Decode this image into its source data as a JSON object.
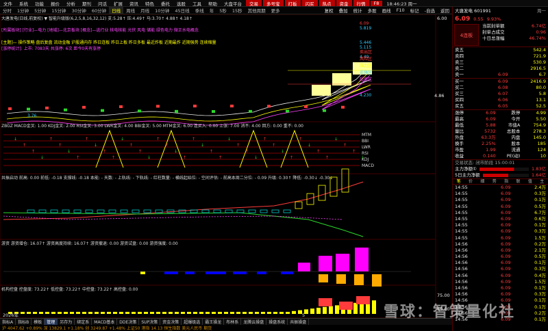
{
  "menu": {
    "items": [
      "文件",
      "系统",
      "功能",
      "报价",
      "分析",
      "期刊",
      "问话",
      "扩展",
      "资讯",
      "特色",
      "委托",
      "选股",
      "工具",
      "帮助",
      "大盘平台"
    ],
    "red_items": [
      "交易",
      "多号宝",
      "打板",
      "闪买",
      "热点",
      "资金",
      "行情",
      "F8"
    ],
    "time": "18:46:23 周一"
  },
  "toolbar": {
    "periods": [
      "分时",
      "1分钟",
      "5分钟",
      "15分钟",
      "30分钟",
      "60分钟",
      "日线",
      "周线",
      "月线",
      "10分钟",
      "45日线",
      "季线",
      "年",
      "5秒",
      "15秒",
      "其他周期",
      "更多"
    ],
    "selected": "日线",
    "right_items": [
      "复权",
      "叠加",
      "统计",
      "多股",
      "画线",
      "F10",
      "标记",
      "-自选",
      "返回"
    ]
  },
  "main_panel": {
    "header": "大唐发电(日线,前复权) ▼ 智能升级版(6,2,5,8,16,32,12) 支:5.28↑ 压:4.49↑ 马:3.70↑ 4.88↑ 4.18↑",
    "line1": "[所属板块]  [行业]—电力  [地域]—北京板块  [概念]—选行业 核电核能 光伏 风电 储能 绿色电力 微正水电概念",
    "line2": "[主题]—  操作策略  盘后复盘 流动金融 沪股通内存 昨日连板 昨日上板 昨日多板 最近炸板 近期最炸 近期强势 连续缩量",
    "line3": "[涨停统计]:  上市: 7083天   共涨停: 6次   距今0天有涨停",
    "price_labels": [
      "6.09",
      "5.819",
      "5.446",
      "5.115",
      "4.230",
      "4.49",
      "3.76"
    ],
    "zone_labels": [
      "卖出区",
      "风险区",
      "压力区",
      "买强区",
      "超卖区"
    ],
    "axis": [
      "6.00",
      "5.00",
      "4.00",
      "4.86"
    ]
  },
  "panel2": {
    "header": "ZBGZ  MACD金叉: 1.00  KDJ金叉: 2.00  RSI金叉: 3.00  LWR金叉: 4.00  BBI金叉: 5.00  MTM金叉: 6.00  连买入: 0.00  上张: 7.00  消不: 4.00  回方: 0.00  重不: 0.00",
    "legend": [
      "MTM",
      "BBI",
      "LWR",
      "RSI",
      "KDJ",
      "MACD"
    ]
  },
  "panel3": {
    "header": "共振启动  前高: 0.00  前低: -0.18  支撑线: -0.18  本能: - 天数: - 上轨线: - 下轨线: - 红柱数量: - 横线起始位: - 空间评估: - 前高本周二分位: - 0.09  升级: 0.30↑  降低: -0.30↓  -0.30↓"
  },
  "panel4": {
    "header": "游资  游资增仓: 16.07↑  游资高度持续: 16.07↑  游资撤退: 0.00  游资试盘: 0.00  游资强度: 0.00"
  },
  "panel5": {
    "header": "机构控盘  控盘度: 73.22↑  低控盘: 73.22↑  中控盘: 73.22↑  高控盘: 0.00",
    "axis": [
      "75.00",
      "50.00"
    ]
  },
  "timeline": {
    "label": "2026年",
    "marker": "5"
  },
  "bottom_tabs": [
    "指标A",
    "指标B",
    "模板",
    "管理",
    "另存为",
    "绑定系",
    "MACD基本",
    "DDE决策",
    "SUP决策",
    "资金决策",
    "超爆级选",
    "霸王操龙",
    "布林系",
    "龙腾云操盘",
    "操盘系统",
    "共振操盘"
  ],
  "bottom_tab_selected": "管理",
  "bottom_status": "沪 4047.62  +0.89%   深 13829.1  +1.18%   创 3249.87  +1.48%   上证50  港指 14.13  恒生指数  美元人民币  期货",
  "quote": {
    "name": "大唐发电 601991",
    "extra": "周一",
    "price": "6.09",
    "change": "0.55",
    "pct": "9.93%",
    "stats": [
      {
        "label": "当前封单额",
        "value": "6.74亿"
      },
      {
        "label": "封单占成交",
        "value": "0.96"
      },
      {
        "label": "十日总涨幅",
        "value": "46.74%"
      }
    ],
    "board_tag": "4连板",
    "asks": [
      {
        "label": "卖五",
        "price": "",
        "vol": "542.4"
      },
      {
        "label": "卖四",
        "price": "",
        "vol": "721.9"
      },
      {
        "label": "卖三",
        "price": "",
        "vol": "530.9"
      },
      {
        "label": "卖二",
        "price": "",
        "vol": "2916.5"
      },
      {
        "label": "卖一",
        "price": "6.09",
        "vol": "6.7"
      }
    ],
    "bids": [
      {
        "label": "买一",
        "price": "6.09",
        "vol": "2416.9"
      },
      {
        "label": "买二",
        "price": "6.08",
        "vol": "80.0"
      },
      {
        "label": "买三",
        "price": "6.07",
        "vol": "5.8"
      },
      {
        "label": "买四",
        "price": "6.06",
        "vol": "13.1"
      },
      {
        "label": "买五",
        "price": "6.05",
        "vol": "52.5"
      }
    ],
    "details": [
      {
        "l1": "涨停",
        "v1": "6.09",
        "l2": "跌停",
        "v2": "4.99"
      },
      {
        "l1": "最高",
        "v1": "6.09",
        "l2": "今开",
        "v2": "5.50"
      },
      {
        "l1": "最低",
        "v1": "5.88",
        "l2": "市值A",
        "v2": "754.9"
      },
      {
        "l1": "量比",
        "v1": "5732",
        "l2": "总股本",
        "v2": "278.3"
      },
      {
        "l1": "外盘",
        "v1": "63.3万",
        "l2": "内盘",
        "v2": "145.0"
      },
      {
        "l1": "换手",
        "v1": "2.25%",
        "l2": "股本",
        "v2": "185"
      },
      {
        "l1": "市盈",
        "v1": "1.99",
        "l2": "流通",
        "v2": "124"
      },
      {
        "l1": "收益",
        "v1": "0.140",
        "l2": "PE(动)",
        "v2": "10"
      }
    ],
    "status": "交易状态: 闭市阶段 15:00:01",
    "flows": [
      {
        "label": "主力净额①",
        "value": "1.83亿"
      },
      {
        "label": "5日主力净额",
        "value": "1.64亿"
      }
    ],
    "tabs": [
      "笔",
      "价",
      "细",
      "势",
      "指",
      "联",
      "值",
      "主"
    ],
    "ticks": [
      {
        "t": "14:55",
        "p": "6.09",
        "v": "2.4万"
      },
      {
        "t": "14:55",
        "p": "6.09",
        "v": "0.3万"
      },
      {
        "t": "14:55",
        "p": "6.09",
        "v": "0.1万"
      },
      {
        "t": "14:55",
        "p": "6.09",
        "v": "0.5万"
      },
      {
        "t": "14:55",
        "p": "6.09",
        "v": "6.7万"
      },
      {
        "t": "14:55",
        "p": "6.09",
        "v": "0.6万"
      },
      {
        "t": "14:55",
        "p": "6.09",
        "v": "0.1万"
      },
      {
        "t": "14:55",
        "p": "6.09",
        "v": "0.3万"
      },
      {
        "t": "14:55",
        "p": "6.09",
        "v": "1.5万"
      },
      {
        "t": "14:56",
        "p": "6.09",
        "v": "0.2万"
      },
      {
        "t": "14:56",
        "p": "6.09",
        "v": "2.1万"
      },
      {
        "t": "14:56",
        "p": "6.09",
        "v": "0.5万"
      },
      {
        "t": "14:56",
        "p": "6.09",
        "v": "0.1万"
      },
      {
        "t": "14:56",
        "p": "6.09",
        "v": "0.3万"
      },
      {
        "t": "14:56",
        "p": "6.09",
        "v": "0.4万"
      },
      {
        "t": "14:56",
        "p": "6.09",
        "v": "1.5万"
      },
      {
        "t": "14:56",
        "p": "6.09",
        "v": "0.1万"
      },
      {
        "t": "14:56",
        "p": "6.09",
        "v": "0.3万"
      },
      {
        "t": "14:56",
        "p": "6.09",
        "v": "0.1万"
      },
      {
        "t": "14:56",
        "p": "6.09",
        "v": "0.1万"
      },
      {
        "t": "14:56",
        "p": "6.09",
        "v": "0.2万"
      },
      {
        "t": "14:56",
        "p": "6.09",
        "v": "0.1万"
      }
    ]
  },
  "watermark": "雪球：智策量化社",
  "colors": {
    "up": "#ff3b3b",
    "down": "#2bd92b",
    "accent": "#ffff00",
    "panel_border": "#550000"
  }
}
